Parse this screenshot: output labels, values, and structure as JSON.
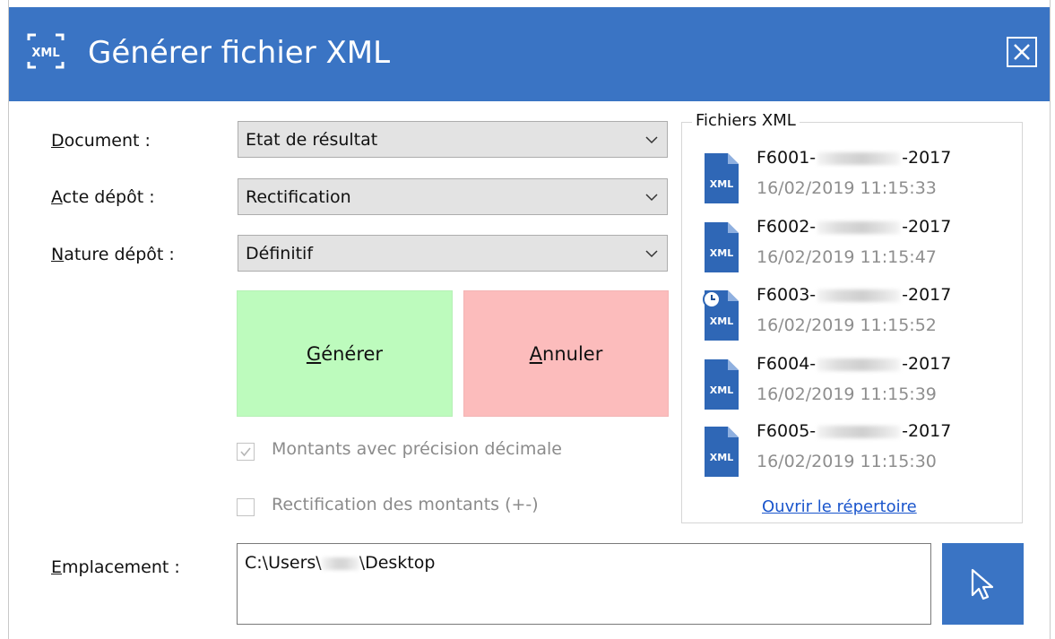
{
  "window": {
    "title": "Générer fichier XML",
    "app_icon": "xml-icon",
    "title_color": "#3a74c4"
  },
  "form": {
    "document": {
      "label_key": "D",
      "label_rest": "ocument :",
      "value": "Etat de résultat"
    },
    "acte": {
      "label_key": "A",
      "label_rest": "cte dépôt :",
      "value": "Rectification"
    },
    "nature": {
      "label_key": "N",
      "label_rest": "ature dépôt :",
      "value": "Définitif"
    }
  },
  "buttons": {
    "generate": {
      "key": "G",
      "rest": "énérer",
      "color": "#bdfbbd"
    },
    "cancel": {
      "key": "A",
      "rest": "nnuler",
      "color": "#fcbcbc"
    }
  },
  "options": {
    "decimal_precision": {
      "label": "Montants avec précision décimale",
      "checked": true
    },
    "amount_rectification": {
      "label": "Rectification des montants (+-)",
      "checked": false
    }
  },
  "files_panel": {
    "title": "Fichiers XML",
    "items": [
      {
        "prefix": "F6001-",
        "suffix": "-2017",
        "date": "16/02/2019 11:15:33",
        "icon": "xml-file-icon"
      },
      {
        "prefix": "F6002-",
        "suffix": "-2017",
        "date": "16/02/2019 11:15:47",
        "icon": "xml-file-icon"
      },
      {
        "prefix": "F6003-",
        "suffix": "-2017",
        "date": "16/02/2019 11:15:52",
        "icon": "xml-file-clock-icon"
      },
      {
        "prefix": "F6004-",
        "suffix": "-2017",
        "date": "16/02/2019 11:15:39",
        "icon": "xml-file-icon"
      },
      {
        "prefix": "F6005-",
        "suffix": "-2017",
        "date": "16/02/2019 11:15:30",
        "icon": "xml-file-icon"
      }
    ],
    "open_link": "Ouvrir le répertoire"
  },
  "location": {
    "label_key": "E",
    "label_rest": "mplacement :",
    "path_start": "C:\\Users\\",
    "path_end": "\\Desktop"
  }
}
